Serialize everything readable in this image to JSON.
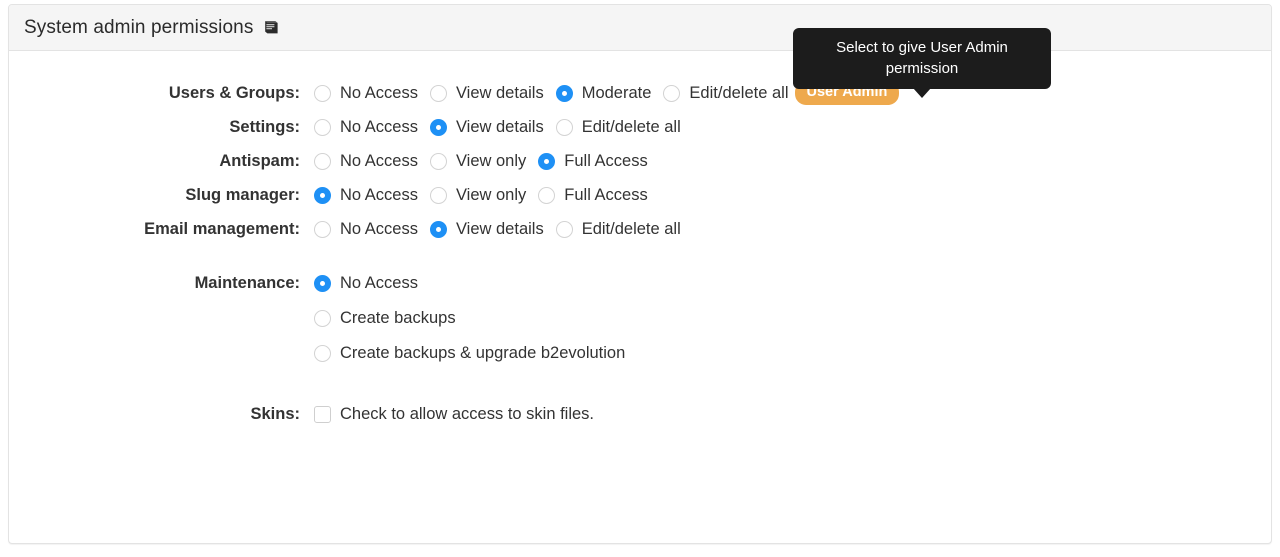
{
  "panel": {
    "title": "System admin permissions",
    "manual_icon": "manual-book-icon"
  },
  "tooltip": {
    "text": "Select to give User Admin permission"
  },
  "colors": {
    "radio_checked": "#1e90f5",
    "badge_background": "#eea94d",
    "tooltip_background": "#1c1c1c",
    "header_background": "#f5f5f5",
    "panel_border": "#e3e3e3"
  },
  "rows": [
    {
      "label": "Users & Groups:",
      "options": [
        {
          "label": "No Access",
          "checked": false
        },
        {
          "label": "View details",
          "checked": false
        },
        {
          "label": "Moderate",
          "checked": true
        },
        {
          "label": "Edit/delete all",
          "checked": false
        }
      ],
      "badge": "User Admin"
    },
    {
      "label": "Settings:",
      "options": [
        {
          "label": "No Access",
          "checked": false
        },
        {
          "label": "View details",
          "checked": true
        },
        {
          "label": "Edit/delete all",
          "checked": false
        }
      ]
    },
    {
      "label": "Antispam:",
      "options": [
        {
          "label": "No Access",
          "checked": false
        },
        {
          "label": "View only",
          "checked": false
        },
        {
          "label": "Full Access",
          "checked": true
        }
      ]
    },
    {
      "label": "Slug manager:",
      "options": [
        {
          "label": "No Access",
          "checked": true
        },
        {
          "label": "View only",
          "checked": false
        },
        {
          "label": "Full Access",
          "checked": false
        }
      ]
    },
    {
      "label": "Email management:",
      "options": [
        {
          "label": "No Access",
          "checked": false
        },
        {
          "label": "View details",
          "checked": true
        },
        {
          "label": "Edit/delete all",
          "checked": false
        }
      ]
    },
    {
      "label": "Maintenance:",
      "stacked": true,
      "options": [
        {
          "label": "No Access",
          "checked": true
        },
        {
          "label": "Create backups",
          "checked": false
        },
        {
          "label": "Create backups & upgrade b2evolution",
          "checked": false
        }
      ]
    }
  ],
  "skins": {
    "label": "Skins:",
    "checkbox_label": "Check to allow access to skin files.",
    "checked": false
  }
}
